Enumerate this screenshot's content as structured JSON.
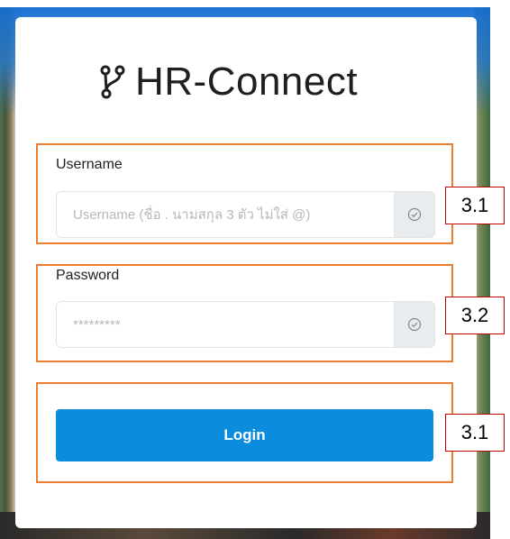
{
  "app": {
    "title": "HR-Connect"
  },
  "form": {
    "username": {
      "label": "Username",
      "placeholder": "Username (ชื่อ . นามสกุล 3 ตัว ไม่ใส่ @)",
      "value": ""
    },
    "password": {
      "label": "Password",
      "placeholder": "*********",
      "value": ""
    },
    "login_label": "Login"
  },
  "annotations": {
    "callout_username": "3.1",
    "callout_password": "3.2",
    "callout_login": "3.1"
  },
  "colors": {
    "primary_button": "#0b8cdc",
    "highlight_border": "#ed7d31",
    "callout_border": "#c00000"
  },
  "icons": {
    "logo": "git-branch-icon",
    "input_addon": "check-circle-icon"
  }
}
